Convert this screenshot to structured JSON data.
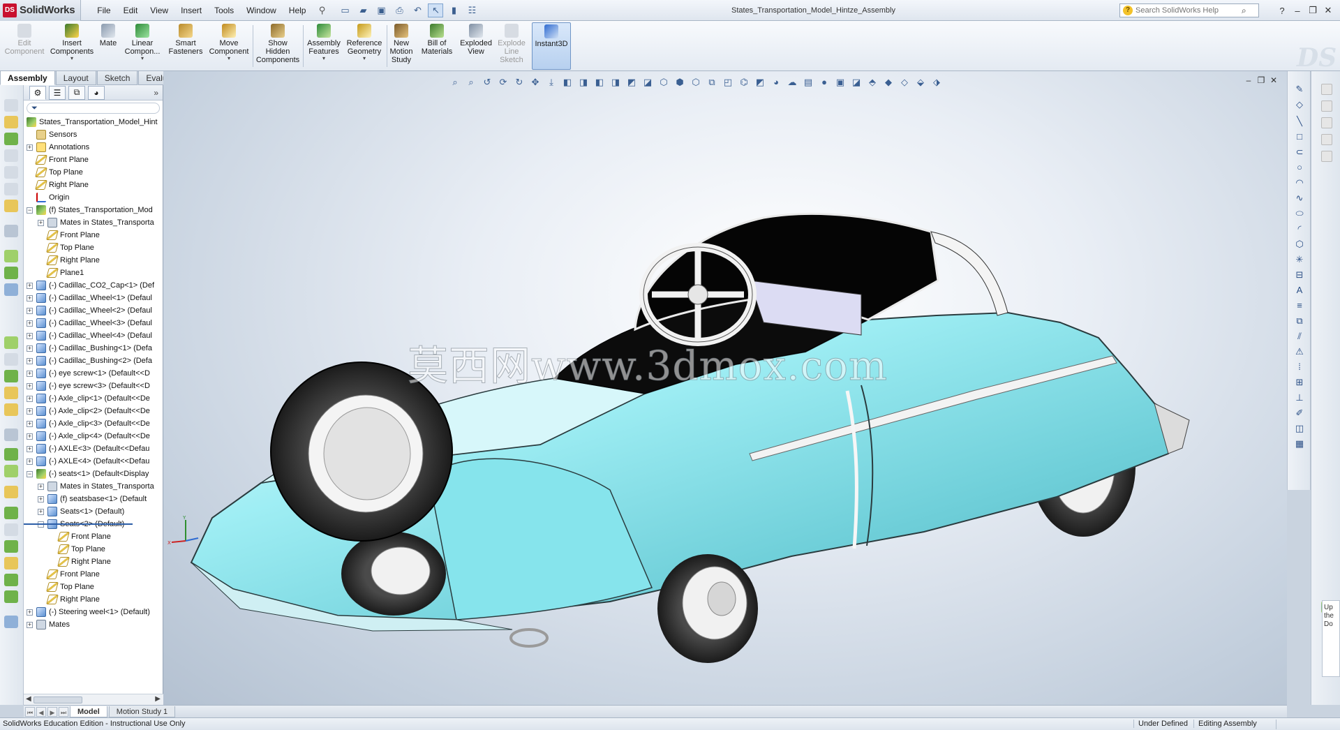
{
  "app": {
    "name": "SolidWorks",
    "doc_title": "States_Transportation_Model_Hintze_Assembly"
  },
  "menu": [
    "File",
    "Edit",
    "View",
    "Insert",
    "Tools",
    "Window",
    "Help"
  ],
  "search": {
    "placeholder": "Search SolidWorks Help"
  },
  "commands": [
    {
      "label": "Edit Component",
      "enabled": false
    },
    {
      "label": "Insert Components",
      "enabled": true
    },
    {
      "label": "Mate",
      "enabled": true
    },
    {
      "label": "Linear Compon...",
      "enabled": true
    },
    {
      "label": "Smart Fasteners",
      "enabled": true
    },
    {
      "label": "Move Component",
      "enabled": true
    },
    {
      "label": "Show Hidden Components",
      "enabled": true
    },
    {
      "label": "Assembly Features",
      "enabled": true
    },
    {
      "label": "Reference Geometry",
      "enabled": true
    },
    {
      "label": "New Motion Study",
      "enabled": true
    },
    {
      "label": "Bill of Materials",
      "enabled": true
    },
    {
      "label": "Exploded View",
      "enabled": true
    },
    {
      "label": "Explode Line Sketch",
      "enabled": false
    },
    {
      "label": "Instant3D",
      "enabled": true,
      "selected": true
    }
  ],
  "cmd_tabs": [
    "Assembly",
    "Layout",
    "Sketch",
    "Evaluate"
  ],
  "tree": {
    "root": "States_Transportation_Model_Hint",
    "rows": [
      {
        "label": "Sensors",
        "icon": "sensor-icon",
        "indent": 1,
        "toggle": ""
      },
      {
        "label": "Annotations",
        "icon": "annotation-icon",
        "indent": 1,
        "toggle": "+"
      },
      {
        "label": "Front Plane",
        "icon": "plane-icon",
        "indent": 1,
        "toggle": ""
      },
      {
        "label": "Top Plane",
        "icon": "plane-icon",
        "indent": 1,
        "toggle": ""
      },
      {
        "label": "Right Plane",
        "icon": "plane-icon",
        "indent": 1,
        "toggle": ""
      },
      {
        "label": "Origin",
        "icon": "origin-icon",
        "indent": 1,
        "toggle": ""
      },
      {
        "label": "(f) States_Transportation_Mod",
        "icon": "subassembly-icon",
        "indent": 1,
        "toggle": "-"
      },
      {
        "label": "Mates in States_Transporta",
        "icon": "mates-icon",
        "indent": 2,
        "toggle": "+"
      },
      {
        "label": "Front Plane",
        "icon": "plane-icon",
        "indent": 2,
        "toggle": ""
      },
      {
        "label": "Top Plane",
        "icon": "plane-icon",
        "indent": 2,
        "toggle": ""
      },
      {
        "label": "Right Plane",
        "icon": "plane-icon",
        "indent": 2,
        "toggle": ""
      },
      {
        "label": "Plane1",
        "icon": "plane-icon",
        "indent": 2,
        "toggle": ""
      },
      {
        "label": "(-) Cadillac_CO2_Cap<1> (Def",
        "icon": "part-icon",
        "indent": 1,
        "toggle": "+"
      },
      {
        "label": "(-) Cadillac_Wheel<1> (Defaul",
        "icon": "part-icon",
        "indent": 1,
        "toggle": "+"
      },
      {
        "label": "(-) Cadillac_Wheel<2> (Defaul",
        "icon": "part-icon",
        "indent": 1,
        "toggle": "+"
      },
      {
        "label": "(-) Cadillac_Wheel<3> (Defaul",
        "icon": "part-icon",
        "indent": 1,
        "toggle": "+"
      },
      {
        "label": "(-) Cadillac_Wheel<4> (Defaul",
        "icon": "part-icon",
        "indent": 1,
        "toggle": "+"
      },
      {
        "label": "(-) Cadillac_Bushing<1> (Defa",
        "icon": "part-icon",
        "indent": 1,
        "toggle": "+"
      },
      {
        "label": "(-) Cadillac_Bushing<2> (Defa",
        "icon": "part-icon",
        "indent": 1,
        "toggle": "+"
      },
      {
        "label": "(-) eye screw<1> (Default<<D",
        "icon": "part-icon",
        "indent": 1,
        "toggle": "+"
      },
      {
        "label": "(-) eye screw<3> (Default<<D",
        "icon": "part-icon",
        "indent": 1,
        "toggle": "+"
      },
      {
        "label": "(-) Axle_clip<1> (Default<<De",
        "icon": "part-icon",
        "indent": 1,
        "toggle": "+"
      },
      {
        "label": "(-) Axle_clip<2> (Default<<De",
        "icon": "part-icon",
        "indent": 1,
        "toggle": "+"
      },
      {
        "label": "(-) Axle_clip<3> (Default<<De",
        "icon": "part-icon",
        "indent": 1,
        "toggle": "+"
      },
      {
        "label": "(-) Axle_clip<4> (Default<<De",
        "icon": "part-icon",
        "indent": 1,
        "toggle": "+"
      },
      {
        "label": "(-) AXLE<3> (Default<<Defau",
        "icon": "part-icon",
        "indent": 1,
        "toggle": "+"
      },
      {
        "label": "(-) AXLE<4> (Default<<Defau",
        "icon": "part-icon",
        "indent": 1,
        "toggle": "+"
      },
      {
        "label": "(-) seats<1> (Default<Display",
        "icon": "subassembly-icon",
        "indent": 1,
        "toggle": "-"
      },
      {
        "label": "Mates in States_Transporta",
        "icon": "mates-icon",
        "indent": 2,
        "toggle": "+"
      },
      {
        "label": "(f) seatsbase<1> (Default",
        "icon": "part-icon",
        "indent": 2,
        "toggle": "+"
      },
      {
        "label": "Seats<1> (Default)",
        "icon": "part-icon",
        "indent": 2,
        "toggle": "+"
      },
      {
        "label": "Seats<2> (Default)",
        "icon": "part-icon",
        "indent": 2,
        "toggle": "-"
      },
      {
        "label": "Front Plane",
        "icon": "plane-icon",
        "indent": 3,
        "toggle": ""
      },
      {
        "label": "Top Plane",
        "icon": "plane-icon",
        "indent": 3,
        "toggle": ""
      },
      {
        "label": "Right Plane",
        "icon": "plane-icon",
        "indent": 3,
        "toggle": ""
      },
      {
        "label": "Front Plane",
        "icon": "plane-icon",
        "indent": 2,
        "toggle": ""
      },
      {
        "label": "Top Plane",
        "icon": "plane-icon",
        "indent": 2,
        "toggle": ""
      },
      {
        "label": "Right Plane",
        "icon": "plane-icon",
        "indent": 2,
        "toggle": ""
      },
      {
        "label": "(-) Steering weel<1> (Default)",
        "icon": "part-icon",
        "indent": 1,
        "toggle": "+"
      },
      {
        "label": "Mates",
        "icon": "mates-icon",
        "indent": 1,
        "toggle": "+"
      }
    ]
  },
  "watermark": "莫西网www.3dmox.com",
  "bottom_tabs": [
    "Model",
    "Motion Study 1"
  ],
  "status": {
    "left": "SolidWorks Education Edition - Instructional Use Only",
    "state": "Under Defined",
    "mode": "Editing Assembly"
  },
  "task_pane_text": "Up the Do",
  "colors": {
    "car_body": "#8fe3ea",
    "accent": "#c8102e",
    "viewport_bg": "#dfe6ef"
  }
}
